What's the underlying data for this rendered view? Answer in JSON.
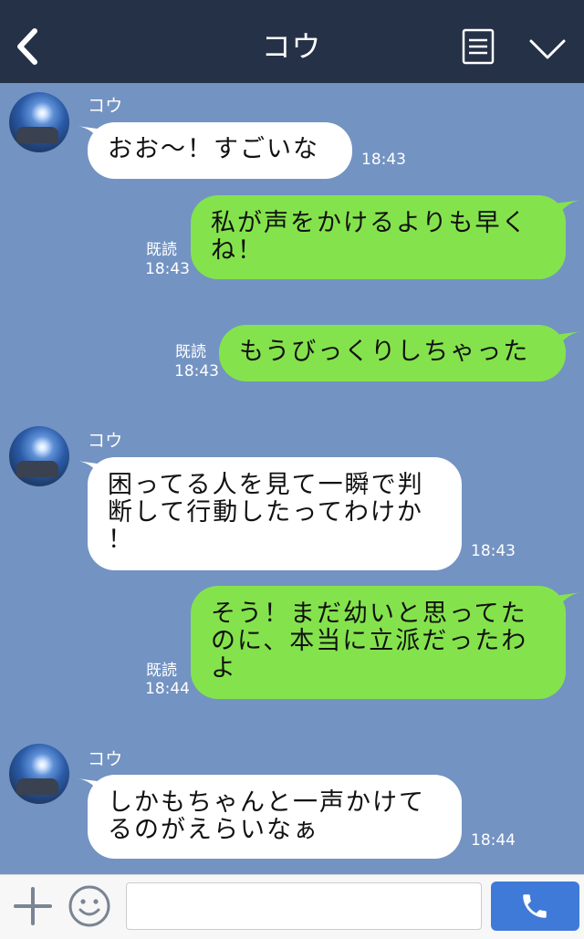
{
  "header": {
    "title": "コウ",
    "back_icon": "chevron-left-icon",
    "menu_icon": "list-icon",
    "collapse_icon": "chevron-down-icon"
  },
  "messages": [
    {
      "sender": "コウ",
      "direction": "incoming",
      "text": "おお〜！すごいな",
      "time": "18:43"
    },
    {
      "direction": "outgoing",
      "text": "私が声をかけるよりも早く\nね！",
      "read": "既読",
      "time": "18:43"
    },
    {
      "direction": "outgoing",
      "text": "もうびっくりしちゃった",
      "read": "既読",
      "time": "18:43"
    },
    {
      "sender": "コウ",
      "direction": "incoming",
      "text": "困ってる人を見て一瞬で判\n断して行動したってわけか\n！",
      "time": "18:43"
    },
    {
      "direction": "outgoing",
      "text": "そう！まだ幼いと思ってた\nのに、本当に立派だったわ\nよ",
      "read": "既読",
      "time": "18:44"
    },
    {
      "sender": "コウ",
      "direction": "incoming",
      "text": "しかもちゃんと一声かけて\nるのがえらいなぁ",
      "time": "18:44"
    }
  ],
  "footer": {
    "plus_icon": "plus-icon",
    "emoji_icon": "smiley-icon",
    "input_value": "",
    "input_placeholder": "",
    "call_icon": "phone-icon"
  },
  "colors": {
    "header_bg": "#253147",
    "chat_bg": "#7393c2",
    "incoming_bubble": "#ffffff",
    "outgoing_bubble": "#84e34c",
    "call_button": "#3f7ad8"
  }
}
